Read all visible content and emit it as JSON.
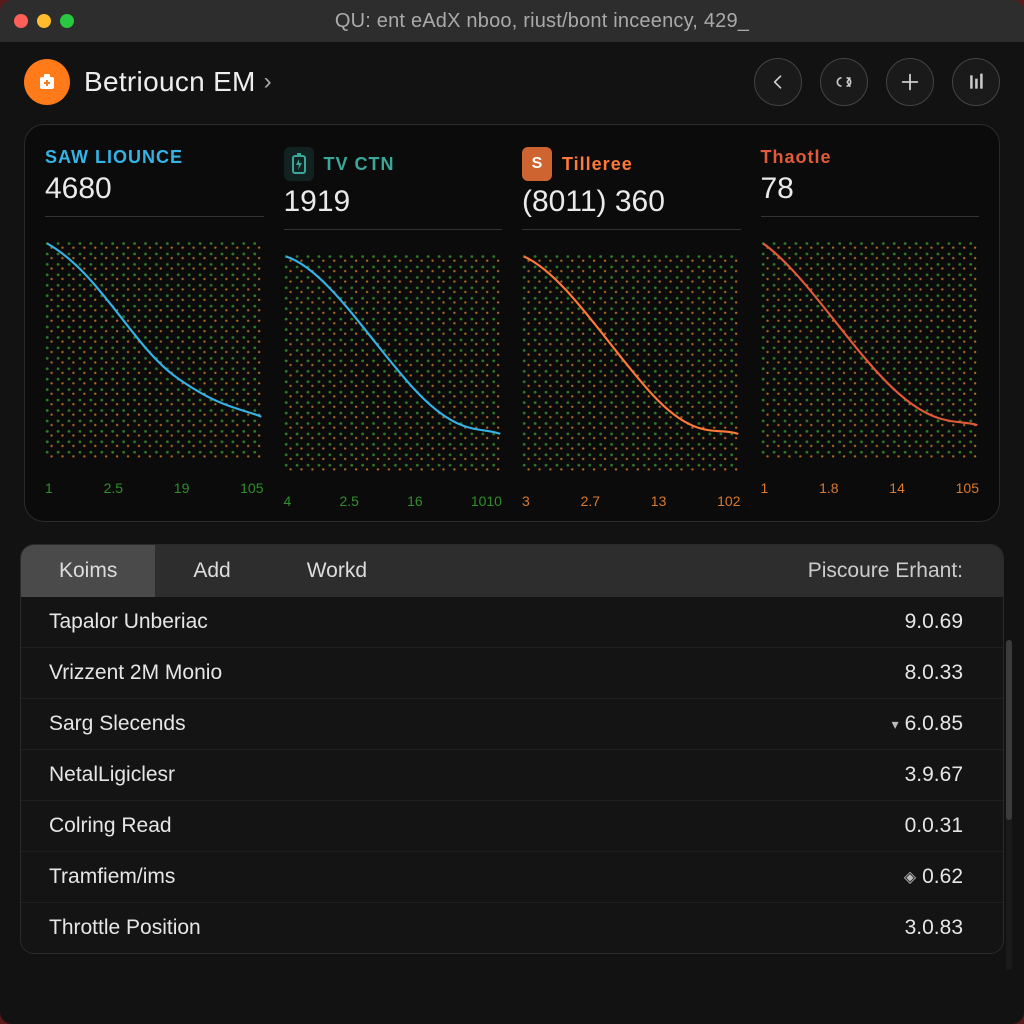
{
  "window": {
    "query": "QU: ent eAdX nboo, riust/bont inceency, 429_"
  },
  "header": {
    "app_name": "Betrioucn EM",
    "chevron": "›"
  },
  "actions": {
    "back_tip": "Back",
    "link_tip": "Link",
    "add_tip": "Add",
    "tune_tip": "Tune"
  },
  "cards": [
    {
      "label": "SAW LIOUNCE",
      "value": "4680",
      "ticks": [
        "1",
        "2.5",
        "19",
        "105"
      ],
      "color": "blue"
    },
    {
      "label": "TV CTN",
      "value": "1919",
      "ticks": [
        "4",
        "2.5",
        "16",
        "1010"
      ],
      "color": "teal",
      "icon": "battery"
    },
    {
      "label": "Tilleree",
      "value": "(8011) 360",
      "ticks": [
        "3",
        "2.7",
        "13",
        "102"
      ],
      "color": "orange",
      "icon": "s-badge"
    },
    {
      "label": "Thaotle",
      "value": "78",
      "ticks": [
        "1",
        "1.8",
        "14",
        "105"
      ],
      "color": "red"
    }
  ],
  "chart_data": [
    {
      "type": "line",
      "title": "SAW LIOUNCE",
      "x": [
        1,
        2.5,
        19,
        105
      ],
      "values": [
        100,
        70,
        45,
        30
      ],
      "ylim": [
        0,
        110
      ],
      "color": "#35b3e6",
      "xticks": [
        "1",
        "2.5",
        "19",
        "105"
      ]
    },
    {
      "type": "line",
      "title": "TV CTN",
      "x": [
        4,
        2.5,
        16,
        1010
      ],
      "values": [
        100,
        72,
        48,
        32
      ],
      "ylim": [
        0,
        110
      ],
      "color": "#3aa79a",
      "xticks": [
        "4",
        "2.5",
        "16",
        "1010"
      ]
    },
    {
      "type": "line",
      "title": "Tilleree",
      "x": [
        3,
        2.7,
        13,
        102
      ],
      "values": [
        100,
        70,
        45,
        30
      ],
      "ylim": [
        0,
        110
      ],
      "color": "#ff7a3a",
      "xticks": [
        "3",
        "2.7",
        "13",
        "102"
      ]
    },
    {
      "type": "line",
      "title": "Thaotle",
      "x": [
        1,
        1.8,
        14,
        105
      ],
      "values": [
        100,
        68,
        42,
        28
      ],
      "ylim": [
        0,
        110
      ],
      "color": "#e25a3a",
      "xticks": [
        "1",
        "1.8",
        "14",
        "105"
      ]
    }
  ],
  "tabs": {
    "items": [
      "Koims",
      "Add",
      "Workd"
    ],
    "active_index": 0,
    "right_label": "Piscoure Erhant:"
  },
  "rows": [
    {
      "name": "Tapalor Unberiac",
      "value": "9.0.69"
    },
    {
      "name": "Vrizzent 2M Monio",
      "value": "8.0.33"
    },
    {
      "name": "Sarg Slecends",
      "value": "6.0.85",
      "prefix": "▾"
    },
    {
      "name": "NetalLigiclesr",
      "value": "3.9.67"
    },
    {
      "name": "Colring Read",
      "value": "0.0.31"
    },
    {
      "name": "Tramfiem/ims",
      "value": "0.62",
      "prefix": "◈"
    },
    {
      "name": "Throttle Position",
      "value": "3.0.83"
    }
  ]
}
